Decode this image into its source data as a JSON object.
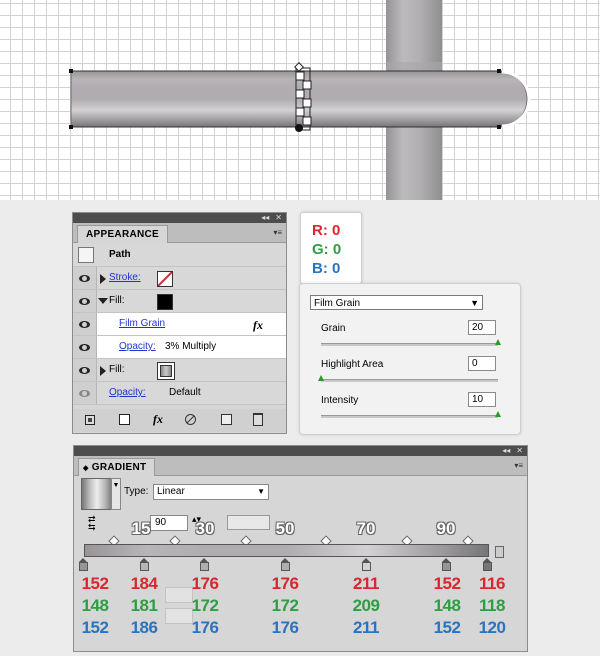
{
  "appearance": {
    "tab_label": "APPEARANCE",
    "path_label": "Path",
    "stroke_label": "Stroke:",
    "fill_label_1": "Fill:",
    "effect_label": "Film Grain",
    "effect_fx": "fx",
    "opacity_label_1": "Opacity:",
    "opacity_value_1": "3% Multiply",
    "fill_label_2": "Fill:",
    "opacity_label_2": "Opacity:",
    "opacity_value_2": "Default",
    "bottom_fx": "fx"
  },
  "color_readout": {
    "r": "R: 0",
    "g": "G: 0",
    "b": "B: 0"
  },
  "film_grain": {
    "filter": "Film Grain",
    "grain_label": "Grain",
    "grain_value": "20",
    "grain_level": 20,
    "highlight_label": "Highlight Area",
    "highlight_value": "0",
    "highlight_level": 0,
    "intensity_label": "Intensity",
    "intensity_value": "10",
    "intensity_level": 10
  },
  "gradient": {
    "tab_label": "GRADIENT",
    "type_label": "Type:",
    "type_value": "Linear",
    "angle_value": "90",
    "stop_locations": [
      "15",
      "30",
      "50",
      "70",
      "90"
    ],
    "stops": [
      {
        "r": "152",
        "g": "148",
        "b": "152"
      },
      {
        "r": "184",
        "g": "181",
        "b": "186"
      },
      {
        "r": "176",
        "g": "172",
        "b": "176"
      },
      {
        "r": "176",
        "g": "172",
        "b": "176"
      },
      {
        "r": "211",
        "g": "209",
        "b": "211"
      },
      {
        "r": "152",
        "g": "148",
        "b": "152"
      },
      {
        "r": "116",
        "g": "118",
        "b": "120"
      }
    ]
  },
  "colors": {
    "red": "#d9262f",
    "green": "#2e9e45",
    "blue": "#2a73c0",
    "panel_dark": "#4d4d4d"
  }
}
